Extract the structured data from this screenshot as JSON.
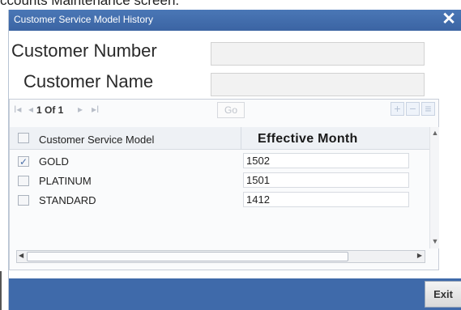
{
  "page_caption": "ccounts Maintenance  screen.",
  "dialog": {
    "title": "Customer Service Model History",
    "close_glyph": "✕"
  },
  "fields": {
    "customer_number_label": "Customer Number",
    "customer_number_value": "",
    "customer_name_label": "Customer Name",
    "customer_name_value": ""
  },
  "pager": {
    "first": "I◂",
    "prev": "◂",
    "page_info": "1 Of 1",
    "next": "▸",
    "last": "▸I",
    "go_label": "Go",
    "add": "+",
    "remove": "−",
    "view": "≡"
  },
  "grid": {
    "columns": [
      "Customer Service Model",
      "Effective Month"
    ],
    "rows": [
      {
        "model": "GOLD",
        "month": "1502",
        "checked": true
      },
      {
        "model": "PLATINUM",
        "month": "1501",
        "checked": false
      },
      {
        "model": "STANDARD",
        "month": "1412",
        "checked": false
      }
    ]
  },
  "footer": {
    "exit_label": "Exit"
  },
  "colors": {
    "titlebar": "#3b64a3",
    "footer": "#3f6aaa"
  }
}
